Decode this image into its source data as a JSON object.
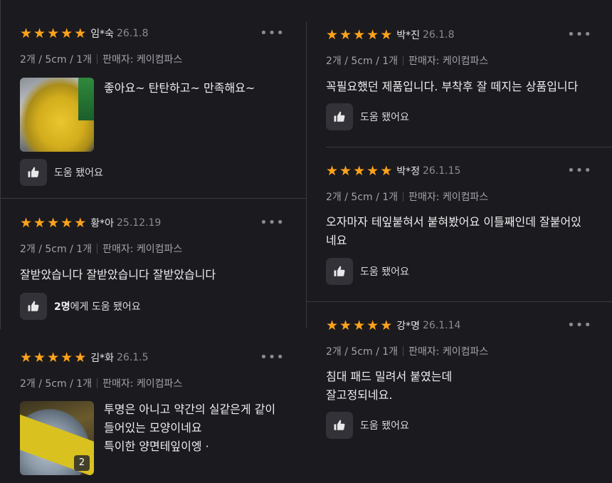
{
  "colors": {
    "background": "#1b1a1f",
    "star": "#ffa31a",
    "button_bg": "#333238"
  },
  "rating_icon": "star-icon",
  "helpful_icon": "thumbs-up-icon",
  "more_icon": "more-dots-icon",
  "more_label": "•••",
  "star_glyph": "★",
  "left": [
    {
      "name": "임*숙",
      "date": "26.1.8",
      "rating": 5,
      "option": "2개 / 5cm / 1개",
      "seller": "판매자: 케이컴파스",
      "text": "좋아요~ 탄탄하고~ 만족해요~",
      "helpful_label": "도움 됐어요"
    },
    {
      "name": "황*아",
      "date": "25.12.19",
      "rating": 5,
      "option": "2개 / 5cm / 1개",
      "seller": "판매자: 케이컴파스",
      "text": "잘받았습니다 잘받았습니다 잘받았습니다",
      "helpful_count": "2명",
      "helpful_label": "에게 도움 됐어요"
    },
    {
      "name": "김*화",
      "date": "26.1.5",
      "rating": 5,
      "option": "2개 / 5cm / 1개",
      "seller": "판매자: 케이컴파스",
      "text_lines": [
        "투명은 아니고 약간의 실같은게 같이",
        "들어있는 모양이네요",
        "특이한 양면테잎이엥 ·"
      ],
      "photo_count": "2"
    }
  ],
  "right": [
    {
      "name": "박*진",
      "date": "26.1.8",
      "rating": 5,
      "option": "2개 / 5cm / 1개",
      "seller": "판매자: 케이컴파스",
      "text": "꼭필요했던 제품입니다. 부착후 잘 떼지는 상품입니다",
      "helpful_label": "도움 됐어요"
    },
    {
      "name": "박*정",
      "date": "26.1.15",
      "rating": 5,
      "option": "2개 / 5cm / 1개",
      "seller": "판매자: 케이컴파스",
      "text_lines": [
        "오자마자 테잎붙혀서 붙혀봤어요 이틀째인데 잘붙어있",
        "네요"
      ],
      "helpful_label": "도움 됐어요"
    },
    {
      "name": "강*명",
      "date": "26.1.14",
      "rating": 5,
      "option": "2개 / 5cm / 1개",
      "seller": "판매자: 케이컴파스",
      "text_lines": [
        "침대 패드 밀려서 붙였는데",
        "잘고정되네요."
      ],
      "helpful_label": "도움 됐어요"
    }
  ]
}
